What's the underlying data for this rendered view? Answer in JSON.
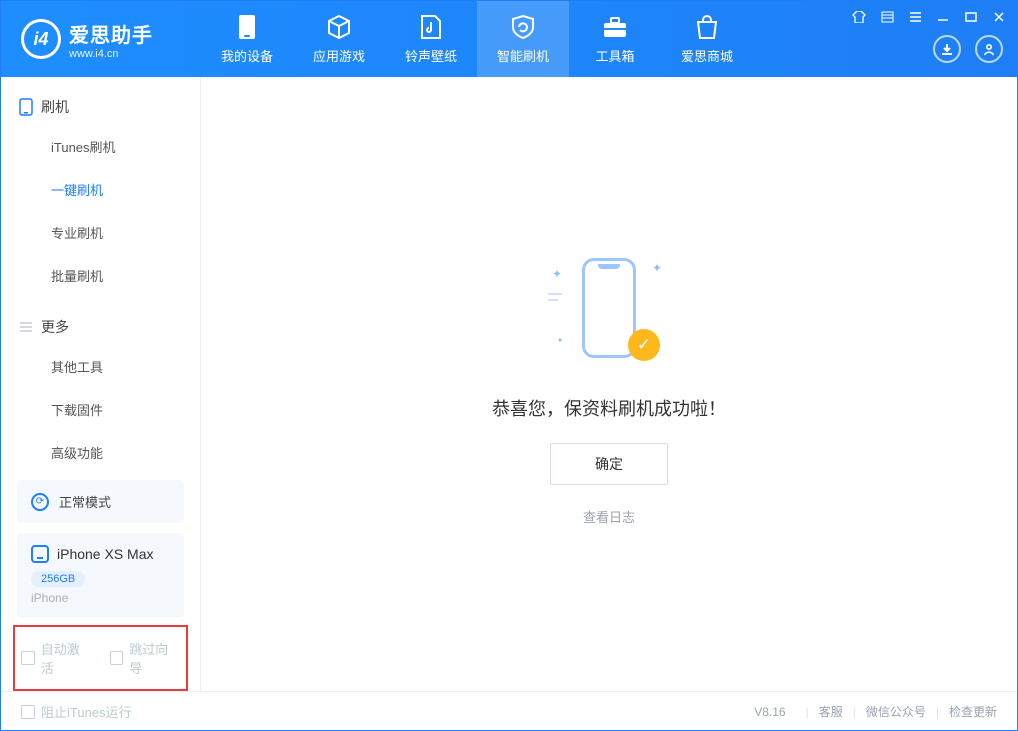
{
  "app": {
    "name": "爱思助手",
    "domain": "www.i4.cn"
  },
  "nav": {
    "items": [
      {
        "label": "我的设备"
      },
      {
        "label": "应用游戏"
      },
      {
        "label": "铃声壁纸"
      },
      {
        "label": "智能刷机"
      },
      {
        "label": "工具箱"
      },
      {
        "label": "爱思商城"
      }
    ]
  },
  "sidebar": {
    "section1": {
      "title": "刷机",
      "items": [
        "iTunes刷机",
        "一键刷机",
        "专业刷机",
        "批量刷机"
      ]
    },
    "section2": {
      "title": "更多",
      "items": [
        "其他工具",
        "下载固件",
        "高级功能"
      ]
    },
    "mode_panel": "正常模式",
    "device": {
      "name": "iPhone XS Max",
      "capacity": "256GB",
      "type": "iPhone"
    },
    "checks": {
      "auto_activate": "自动激活",
      "skip_guide": "跳过向导"
    }
  },
  "main": {
    "success_msg": "恭喜您，保资料刷机成功啦！",
    "ok_btn": "确定",
    "log_link": "查看日志"
  },
  "footer": {
    "block_itunes": "阻止iTunes运行",
    "version": "V8.16",
    "links": [
      "客服",
      "微信公众号",
      "检查更新"
    ]
  }
}
